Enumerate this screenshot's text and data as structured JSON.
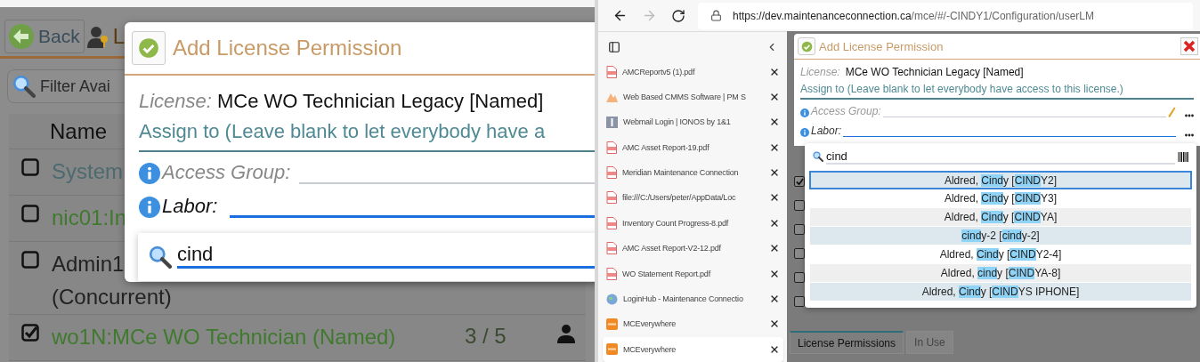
{
  "zoomed_view": {
    "back_button": "Back",
    "toolbar_title": "L",
    "filter": {
      "placeholder": "Filter Avai"
    },
    "table": {
      "columns": [
        "Name"
      ],
      "rows": [
        {
          "name": "System",
          "checked": false,
          "color": "#4c6a70"
        },
        {
          "name": "nic01:In",
          "checked": false,
          "color": "#3f7a2e"
        },
        {
          "name": "Admin1",
          "name_line_2": "(Concurrent)",
          "checked": false,
          "color": "#222222"
        },
        {
          "name": "wo1N:MCe WO Technician (Named)",
          "count": "3 / 5",
          "checked": true,
          "color": "#3f7a2e"
        }
      ]
    },
    "dialog": {
      "title": "Add License Permission",
      "license_label": "License:",
      "license_value": "MCe WO Technician Legacy [Named]",
      "assign_note": "Assign to (Leave blank to let everybody have a",
      "access_group_label": "Access Group:",
      "labor_label": "Labor:",
      "search_value": "cind"
    }
  },
  "browser": {
    "url_host": "https://dev.maintenanceconnection.ca",
    "url_path": "/mce/#/-CINDY1/Configuration/userLM",
    "forward_disabled": true,
    "tabs": [
      {
        "title": "AMCReportv5 (1).pdf",
        "kind": "pdf",
        "selected": false
      },
      {
        "title": "Web Based CMMS Software | PM S",
        "kind": "cmms",
        "selected": false
      },
      {
        "title": "Webmail Login | IONOS by 1&1",
        "kind": "mail",
        "selected": false
      },
      {
        "title": "AMC Asset Report-19.pdf",
        "kind": "pdf",
        "selected": false
      },
      {
        "title": "Meridian Maintenance Connection",
        "kind": "pdf",
        "selected": false
      },
      {
        "title": "file:///C:/Users/peter/AppData/Loc",
        "kind": "pdf",
        "selected": false
      },
      {
        "title": "Inventory Count Progress-8.pdf",
        "kind": "pdf",
        "selected": false
      },
      {
        "title": "AMC Asset Report-V2-12.pdf",
        "kind": "pdf",
        "selected": false
      },
      {
        "title": "WO Statement Report.pdf",
        "kind": "pdf",
        "selected": false
      },
      {
        "title": "LoginHub - Maintenance Connectio",
        "kind": "globe",
        "selected": false
      },
      {
        "title": "MCEverywhere",
        "kind": "mce",
        "selected": false
      },
      {
        "title": "MCEverywhere",
        "kind": "mce",
        "selected": true
      }
    ],
    "dialog": {
      "title": "Add License Permission",
      "license_label": "License:",
      "license_value": "MCe WO Technician Legacy [Named]",
      "assign_note": "Assign to (Leave blank to let everybody have access to this license.)",
      "access_group_label": "Access Group:",
      "labor_label": "Labor:",
      "search_value": "cind"
    },
    "results": [
      {
        "selected": true,
        "segments": [
          {
            "text": "Aldred, ",
            "match": false
          },
          {
            "text": "Cind",
            "match": true
          },
          {
            "text": "y [",
            "match": false
          },
          {
            "text": "CIND",
            "match": true
          },
          {
            "text": "Y2]",
            "match": false
          }
        ]
      },
      {
        "selected": false,
        "segments": [
          {
            "text": "Aldred, ",
            "match": false
          },
          {
            "text": "Cind",
            "match": true
          },
          {
            "text": "y [",
            "match": false
          },
          {
            "text": "CIND",
            "match": true
          },
          {
            "text": "Y3]",
            "match": false
          }
        ]
      },
      {
        "selected": false,
        "segments": [
          {
            "text": "Aldred, ",
            "match": false
          },
          {
            "text": "Cind",
            "match": true
          },
          {
            "text": "y [",
            "match": false
          },
          {
            "text": "CIND",
            "match": true
          },
          {
            "text": "YA]",
            "match": false
          }
        ]
      },
      {
        "selected": false,
        "segments": [
          {
            "text": "cind",
            "match": true
          },
          {
            "text": "y-2 [",
            "match": false
          },
          {
            "text": "cind",
            "match": true
          },
          {
            "text": "y-2]",
            "match": false
          }
        ]
      },
      {
        "selected": false,
        "segments": [
          {
            "text": "Aldred, ",
            "match": false
          },
          {
            "text": "Cind",
            "match": true
          },
          {
            "text": "y [",
            "match": false
          },
          {
            "text": "CIND",
            "match": true
          },
          {
            "text": "Y2-4]",
            "match": false
          }
        ]
      },
      {
        "selected": false,
        "segments": [
          {
            "text": "Aldred, ",
            "match": false
          },
          {
            "text": "cind",
            "match": true
          },
          {
            "text": "y [",
            "match": false
          },
          {
            "text": "CIND",
            "match": true
          },
          {
            "text": "YA-8]",
            "match": false
          }
        ]
      },
      {
        "selected": false,
        "segments": [
          {
            "text": "Aldred, ",
            "match": false
          },
          {
            "text": "Cind",
            "match": true
          },
          {
            "text": "y [",
            "match": false
          },
          {
            "text": "CIND",
            "match": true
          },
          {
            "text": "YS IPHONE]",
            "match": false
          }
        ]
      }
    ],
    "page_checkboxes": [
      {
        "checked": true
      },
      {
        "checked": false
      },
      {
        "checked": false
      },
      {
        "checked": false
      },
      {
        "checked": false
      },
      {
        "checked": false
      }
    ],
    "bottom_tabs": [
      {
        "label": "License Permissions",
        "selected": true
      },
      {
        "label": "In Use",
        "selected": false
      }
    ]
  }
}
